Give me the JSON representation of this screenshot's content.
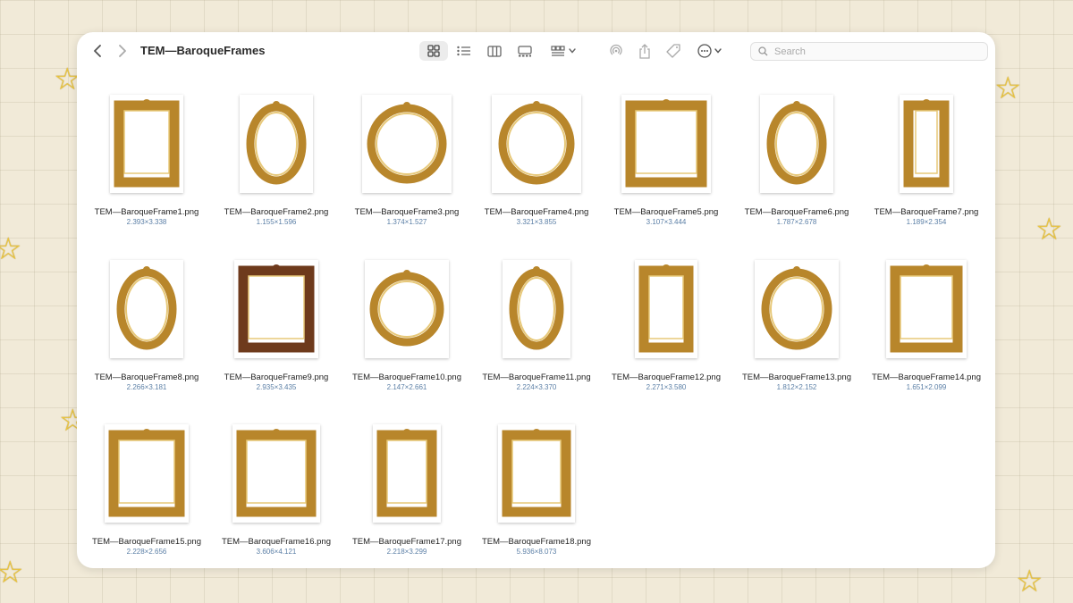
{
  "window": {
    "title": "TEM—BaroqueFrames",
    "search_placeholder": "Search"
  },
  "toolbar_icons": [
    "back-icon",
    "forward-icon",
    "icon-view-icon",
    "list-view-icon",
    "column-view-icon",
    "gallery-view-icon",
    "group-icon",
    "airdrop-icon",
    "share-icon",
    "tag-icon",
    "more-icon",
    "search-icon"
  ],
  "colors": {
    "frame_gold": "#b8862b",
    "frame_dark": "#6e3a1c",
    "accent_blue": "#5b7fa6"
  },
  "files": [
    {
      "name": "TEM—BaroqueFrame1.png",
      "dims": "2.393×3.338"
    },
    {
      "name": "TEM—BaroqueFrame2.png",
      "dims": "1.155×1.596"
    },
    {
      "name": "TEM—BaroqueFrame3.png",
      "dims": "1.374×1.527"
    },
    {
      "name": "TEM—BaroqueFrame4.png",
      "dims": "3.321×3.855"
    },
    {
      "name": "TEM—BaroqueFrame5.png",
      "dims": "3.107×3.444"
    },
    {
      "name": "TEM—BaroqueFrame6.png",
      "dims": "1.787×2.678"
    },
    {
      "name": "TEM—BaroqueFrame7.png",
      "dims": "1.189×2.354"
    },
    {
      "name": "TEM—BaroqueFrame8.png",
      "dims": "2.266×3.181"
    },
    {
      "name": "TEM—BaroqueFrame9.png",
      "dims": "2.935×3.435"
    },
    {
      "name": "TEM—BaroqueFrame10.png",
      "dims": "2.147×2.661"
    },
    {
      "name": "TEM—BaroqueFrame11.png",
      "dims": "2.224×3.370"
    },
    {
      "name": "TEM—BaroqueFrame12.png",
      "dims": "2.271×3.580"
    },
    {
      "name": "TEM—BaroqueFrame13.png",
      "dims": "1.812×2.152"
    },
    {
      "name": "TEM—BaroqueFrame14.png",
      "dims": "1.651×2.099"
    },
    {
      "name": "TEM—BaroqueFrame15.png",
      "dims": "2.228×2.656"
    },
    {
      "name": "TEM—BaroqueFrame16.png",
      "dims": "3.606×4.121"
    },
    {
      "name": "TEM—BaroqueFrame17.png",
      "dims": "2.218×3.299"
    },
    {
      "name": "TEM—BaroqueFrame18.png",
      "dims": "5.936×8.073"
    }
  ]
}
